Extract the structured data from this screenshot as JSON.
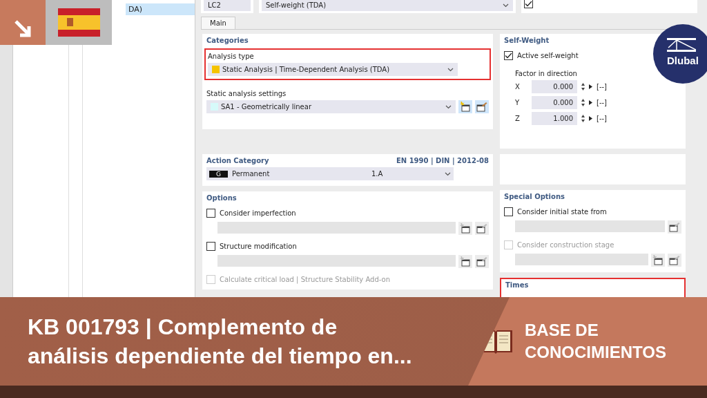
{
  "tree": {
    "items": [
      {
        "label": "DA)",
        "selected": true
      }
    ]
  },
  "header": {
    "number": "LC2",
    "name": "Self-weight (TDA)",
    "checked": true
  },
  "tabs": [
    {
      "label": "Main",
      "selected": true
    }
  ],
  "categories": {
    "title": "Categories",
    "analysis_type": {
      "label": "Analysis type",
      "value": "Static Analysis | Time-Dependent Analysis (TDA)",
      "color": "#f5c400",
      "highlighted": true
    },
    "settings": {
      "label": "Static analysis settings",
      "value": "SA1 - Geometrically linear",
      "color": "#d6fafa"
    }
  },
  "self_weight": {
    "title": "Self-Weight",
    "active": {
      "label": "Active self-weight",
      "checked": true
    },
    "factor_label": "Factor in direction",
    "factors": [
      {
        "axis": "X",
        "value": "0.000",
        "unit": "[--]"
      },
      {
        "axis": "Y",
        "value": "0.000",
        "unit": "[--]"
      },
      {
        "axis": "Z",
        "value": "1.000",
        "unit": "[--]"
      }
    ]
  },
  "action_category": {
    "title": "Action Category",
    "standard": "EN 1990 | DIN | 2012-08",
    "code": "G",
    "name": "Permanent",
    "class": "1.A"
  },
  "options": {
    "title": "Options",
    "items": [
      {
        "label": "Consider imperfection",
        "checked": false,
        "disabled": false,
        "tools": [
          {
            "kind": "new"
          },
          {
            "kind": "edit"
          }
        ]
      },
      {
        "label": "Structure modification",
        "checked": false,
        "disabled": false,
        "tools": [
          {
            "kind": "new"
          },
          {
            "kind": "edit"
          }
        ]
      },
      {
        "label": "Calculate critical load | Structure Stability Add-on",
        "checked": false,
        "disabled": true
      }
    ]
  },
  "special_options": {
    "title": "Special Options",
    "items": [
      {
        "label": "Consider initial state from",
        "checked": false,
        "disabled": false,
        "tools": [
          {
            "kind": "edit"
          }
        ]
      },
      {
        "label": "Consider construction stage",
        "checked": false,
        "disabled": true,
        "tools": [
          {
            "kind": "new"
          },
          {
            "kind": "edit"
          }
        ]
      }
    ]
  },
  "times": {
    "title": "Times",
    "highlighted": true
  },
  "logo": {
    "text": "Dlubal"
  },
  "banner": {
    "title_lines": [
      "KB 001793 | Complemento de",
      "análisis dependiente del tiempo en..."
    ],
    "category": "BASE DE CONOCIMIENTOS"
  }
}
